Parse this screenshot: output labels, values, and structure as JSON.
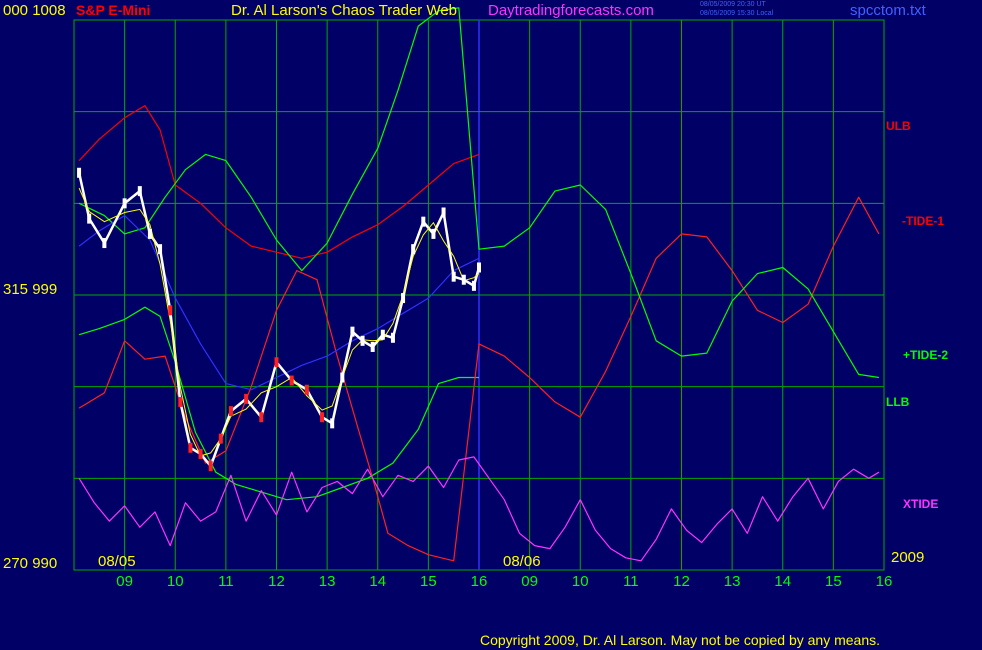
{
  "header": {
    "left_scale_top": "000  1008",
    "instrument": "S&P E-Mini",
    "title": "Dr. Al Larson's Chaos Trader Web",
    "site": "Daytradingforecasts.com",
    "timestamp_ut": "08/05/2009 20:30 UT",
    "timestamp_local": "08/05/2009 15:30 Local",
    "filename": "spcctom.txt"
  },
  "left_scale": {
    "middle": "315  999",
    "bottom": "270  990"
  },
  "right_labels": {
    "ulb": "ULB",
    "tide1": "-TIDE-1",
    "tide2": "+TIDE-2",
    "llb": "LLB",
    "xtide": "XTIDE",
    "year": "2009"
  },
  "footer": {
    "copyright": "Copyright 2009, Dr. Al Larson. May not be copied by any means."
  },
  "colors": {
    "background": "#000066",
    "grid": "#00aa00",
    "price": "#ffffff",
    "ulb": "#ff0000",
    "llb": "#00ff00",
    "tide": "#ff2020",
    "xtide": "#ff33ff",
    "average": "#3030ff",
    "smooth": "#ffff00"
  },
  "chart_data": {
    "type": "line",
    "title": "S&P E-Mini",
    "x_axis": {
      "day_labels": [
        "08/05",
        "08/06"
      ],
      "hour_ticks": [
        "09",
        "10",
        "11",
        "12",
        "13",
        "14",
        "15",
        "16",
        "09",
        "10",
        "11",
        "12",
        "13",
        "14",
        "15",
        "16"
      ]
    },
    "y_axis": {
      "ylim": [
        990,
        1008
      ],
      "tick_labels": [
        "1008",
        "999",
        "990"
      ],
      "secondary_tick_labels": [
        "000",
        "315",
        "270"
      ]
    },
    "grid": true,
    "series": [
      {
        "name": "ULB",
        "x": [
          8.1,
          8.5,
          9.0,
          9.4,
          9.7,
          10.0,
          10.5,
          11.0,
          11.5,
          12.0,
          12.5,
          13.0,
          13.5,
          14.0,
          14.5,
          15.0,
          15.5,
          16.0
        ],
        "y": [
          1003.4,
          1004.1,
          1004.8,
          1005.2,
          1004.4,
          1002.6,
          1002.0,
          1001.2,
          1000.6,
          1000.4,
          1000.2,
          1000.4,
          1000.9,
          1001.3,
          1001.9,
          1002.6,
          1003.3,
          1003.6
        ]
      },
      {
        "name": "LLB",
        "x": [
          8.1,
          8.5,
          9.0,
          9.4,
          9.7,
          10.0,
          10.4,
          10.8,
          11.2,
          11.8,
          12.2,
          12.8,
          13.3,
          13.8,
          14.3,
          14.8,
          15.2,
          15.6,
          16.0
        ],
        "y": [
          997.7,
          997.9,
          998.2,
          998.6,
          998.3,
          996.8,
          994.5,
          993.2,
          992.8,
          992.5,
          992.3,
          992.4,
          992.7,
          993.0,
          993.5,
          994.6,
          996.1,
          996.3,
          996.3
        ]
      },
      {
        "name": "-TIDE-1",
        "x": [
          8.1,
          8.6,
          9.0,
          9.4,
          9.8,
          10.2,
          10.6,
          11.0,
          11.5,
          12.0,
          12.4,
          12.8,
          13.2,
          13.6,
          13.9,
          14.2,
          14.6,
          15.0,
          15.5,
          16.0,
          16.5,
          17.0,
          17.5,
          18.0,
          18.5,
          19.0,
          19.5,
          20.0,
          20.5,
          21.0,
          21.5,
          22.0,
          22.5,
          23.0,
          23.5,
          23.9
        ],
        "y": [
          995.3,
          995.8,
          997.5,
          996.9,
          997.0,
          995.0,
          993.5,
          993.9,
          996.0,
          998.5,
          999.8,
          999.5,
          997.0,
          994.7,
          993.0,
          991.2,
          990.8,
          990.5,
          990.3,
          997.4,
          997.0,
          996.3,
          995.5,
          995.0,
          996.5,
          998.3,
          1000.2,
          1001.0,
          1000.9,
          999.8,
          998.5,
          998.1,
          998.7,
          1000.6,
          1002.2,
          1001.0
        ]
      },
      {
        "name": "+TIDE-2",
        "x": [
          8.1,
          8.6,
          9.0,
          9.4,
          9.8,
          10.2,
          10.6,
          11.0,
          11.5,
          12.0,
          12.5,
          13.0,
          13.5,
          14.0,
          14.4,
          14.8,
          15.2,
          15.6,
          16.0,
          16.5,
          17.0,
          17.5,
          18.0,
          18.5,
          19.0,
          19.5,
          20.0,
          20.5,
          21.0,
          21.5,
          22.0,
          22.5,
          23.0,
          23.5,
          23.9
        ],
        "y": [
          1002.0,
          1001.6,
          1001.0,
          1001.2,
          1002.2,
          1003.1,
          1003.6,
          1003.4,
          1002.2,
          1000.8,
          999.8,
          1000.7,
          1002.3,
          1003.8,
          1005.7,
          1007.8,
          1008.3,
          1008.4,
          1000.5,
          1000.6,
          1001.2,
          1002.4,
          1002.6,
          1001.8,
          999.7,
          997.5,
          997.0,
          997.1,
          998.8,
          999.7,
          999.9,
          999.2,
          997.8,
          996.4,
          996.3
        ]
      },
      {
        "name": "Average",
        "x": [
          8.1,
          8.5,
          9.0,
          9.5,
          10.0,
          10.5,
          11.0,
          11.5,
          12.0,
          12.5,
          13.0,
          13.5,
          14.0,
          14.5,
          15.0,
          15.5,
          16.0
        ],
        "y": [
          1000.6,
          1001.1,
          1001.6,
          1000.8,
          998.9,
          997.4,
          996.1,
          995.9,
          996.3,
          996.7,
          997.0,
          997.5,
          997.9,
          998.4,
          998.9,
          999.8,
          1000.2
        ]
      },
      {
        "name": "Price",
        "x": [
          8.1,
          8.3,
          8.6,
          9.0,
          9.3,
          9.5,
          9.7,
          9.9,
          10.1,
          10.3,
          10.5,
          10.7,
          10.9,
          11.1,
          11.4,
          11.7,
          12.0,
          12.3,
          12.6,
          12.9,
          13.1,
          13.3,
          13.5,
          13.7,
          13.9,
          14.1,
          14.3,
          14.5,
          14.7,
          14.9,
          15.1,
          15.3,
          15.5,
          15.7,
          15.9,
          16.0
        ],
        "y": [
          1003.0,
          1001.5,
          1000.7,
          1002.0,
          1002.4,
          1001.0,
          1000.5,
          998.5,
          995.5,
          994.0,
          993.8,
          993.4,
          994.3,
          995.2,
          995.6,
          995.0,
          996.8,
          996.2,
          995.9,
          995.0,
          994.8,
          996.3,
          997.8,
          997.5,
          997.3,
          997.7,
          997.6,
          998.9,
          1000.5,
          1001.4,
          1001.0,
          1001.7,
          999.6,
          999.5,
          999.3,
          999.9
        ]
      },
      {
        "name": "XTIDE",
        "x": [
          8.1,
          8.4,
          8.7,
          9.0,
          9.3,
          9.6,
          9.9,
          10.2,
          10.5,
          10.8,
          11.1,
          11.4,
          11.7,
          12.0,
          12.3,
          12.6,
          12.9,
          13.2,
          13.5,
          13.8,
          14.1,
          14.4,
          14.7,
          15.0,
          15.3,
          15.6,
          15.9,
          16.2,
          16.5,
          16.8,
          17.1,
          17.4,
          17.7,
          18.0,
          18.3,
          18.6,
          18.9,
          19.2,
          19.5,
          19.8,
          20.1,
          20.4,
          20.7,
          21.0,
          21.3,
          21.6,
          21.9,
          22.2,
          22.5,
          22.8,
          23.1,
          23.4,
          23.7,
          23.9
        ],
        "y": [
          993.0,
          992.2,
          991.6,
          992.1,
          991.4,
          991.9,
          990.8,
          992.2,
          991.6,
          991.9,
          993.1,
          991.6,
          992.6,
          991.8,
          993.2,
          991.9,
          992.7,
          992.9,
          992.5,
          993.3,
          992.4,
          993.1,
          992.9,
          993.4,
          992.7,
          993.6,
          993.7,
          993.0,
          992.3,
          991.2,
          990.8,
          990.7,
          991.4,
          992.3,
          991.3,
          990.7,
          990.4,
          990.3,
          991.0,
          992.0,
          991.3,
          990.9,
          991.5,
          992.0,
          991.2,
          992.4,
          991.6,
          992.4,
          993.0,
          992.0,
          992.9,
          993.3,
          993.0,
          993.2
        ]
      }
    ]
  }
}
